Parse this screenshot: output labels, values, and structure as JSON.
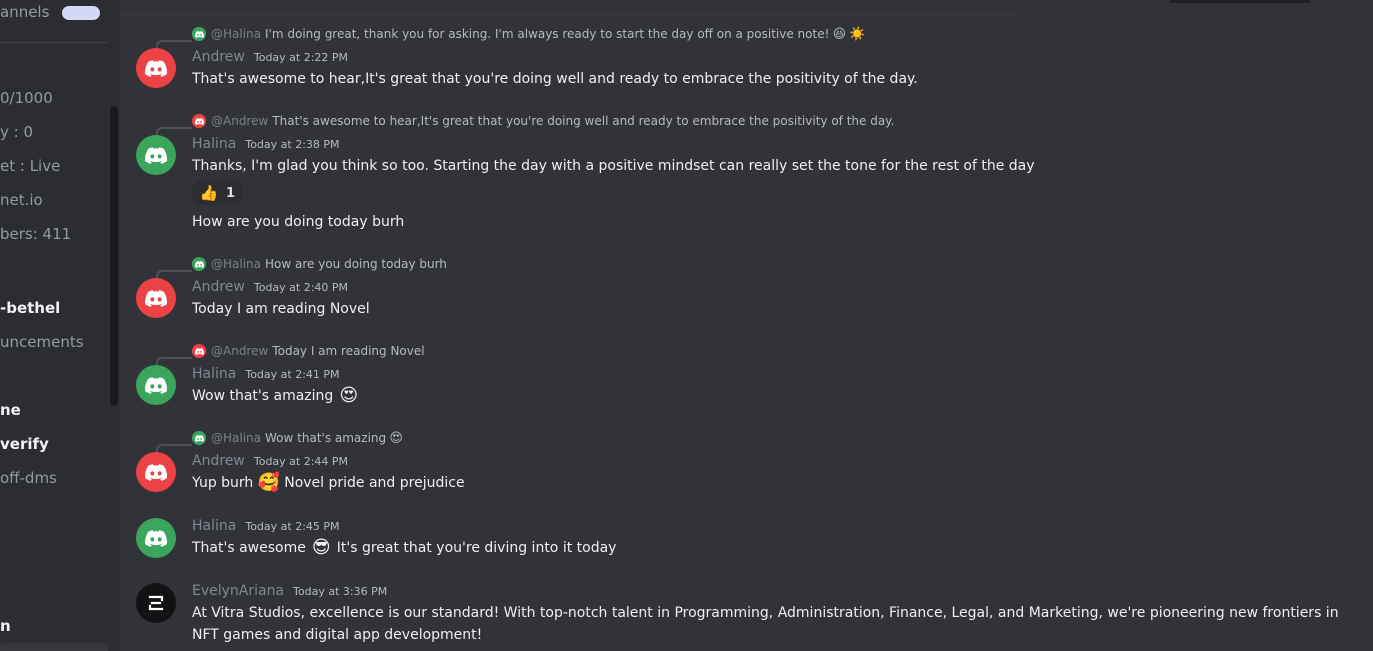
{
  "sidebar": {
    "items": [
      {
        "label": "annels",
        "strong": false
      },
      {
        "label": "0/1000",
        "strong": false
      },
      {
        "label": "y : 0",
        "strong": false
      },
      {
        "label": "et : Live",
        "strong": false
      },
      {
        "label": "net.io",
        "strong": false
      },
      {
        "label": "bers: 411",
        "strong": false
      },
      {
        "label": "-bethel",
        "strong": true
      },
      {
        "label": "uncements",
        "strong": false
      },
      {
        "label": "ne",
        "strong": true
      },
      {
        "label": "verify",
        "strong": true
      },
      {
        "label": "off-dms",
        "strong": false
      },
      {
        "label": "n",
        "strong": true
      }
    ]
  },
  "colors": {
    "background": "#313338",
    "sidebar": "#2b2d31",
    "red_avatar": "#ed4245",
    "green_avatar": "#3ba55c",
    "text": "#eef0f2",
    "muted": "#7f8891"
  },
  "messages": [
    {
      "reply": {
        "name": "@Halina",
        "text": "I'm doing great, thank you for asking. I'm always ready to start the day off on a positive note!",
        "emojis": [
          "😆",
          "☀️"
        ]
      },
      "author": "Andrew",
      "timestamp": "Today at 2:22 PM",
      "text": "That's awesome to hear,It's great that you're doing well and ready to embrace the positivity of the day."
    },
    {
      "reply": {
        "name": "@Andrew",
        "text": "That's awesome to hear,It's great that you're doing well and ready to embrace the positivity of the day."
      },
      "author": "Halina",
      "timestamp": "Today at 2:38 PM",
      "text": "Thanks, I'm glad you think so too. Starting the day with a positive mindset can really set the tone for the rest of the day",
      "reaction": {
        "emoji": "👍",
        "count": "1"
      },
      "followup": "How are you doing today burh"
    },
    {
      "reply": {
        "name": "@Halina",
        "text": "How are you doing today burh"
      },
      "author": "Andrew",
      "timestamp": "Today at 2:40 PM",
      "text": "Today I am reading Novel"
    },
    {
      "reply": {
        "name": "@Andrew",
        "text": "Today I am reading Novel"
      },
      "author": "Halina",
      "timestamp": "Today at 2:41 PM",
      "text": "Wow that's amazing",
      "emoji": "😍"
    },
    {
      "reply": {
        "name": "@Halina",
        "text": "Wow that's amazing",
        "emoji": "😍"
      },
      "author": "Andrew",
      "timestamp": "Today at 2:44 PM",
      "text_before": "Yup burh",
      "emoji": "🥰",
      "text_after": "Novel pride and prejudice"
    },
    {
      "author": "Halina",
      "timestamp": "Today at 2:45 PM",
      "text_before": "That's awesome",
      "emoji": "😎",
      "text_after": "It's great that you're diving into it today"
    },
    {
      "author": "EvelynAriana",
      "timestamp": "Today at 3:36 PM",
      "text": "At Vitra Studios, excellence is our standard! With top-notch talent in Programming, Administration, Finance, Legal, and Marketing, we're pioneering new frontiers in NFT games and digital app development!"
    }
  ]
}
